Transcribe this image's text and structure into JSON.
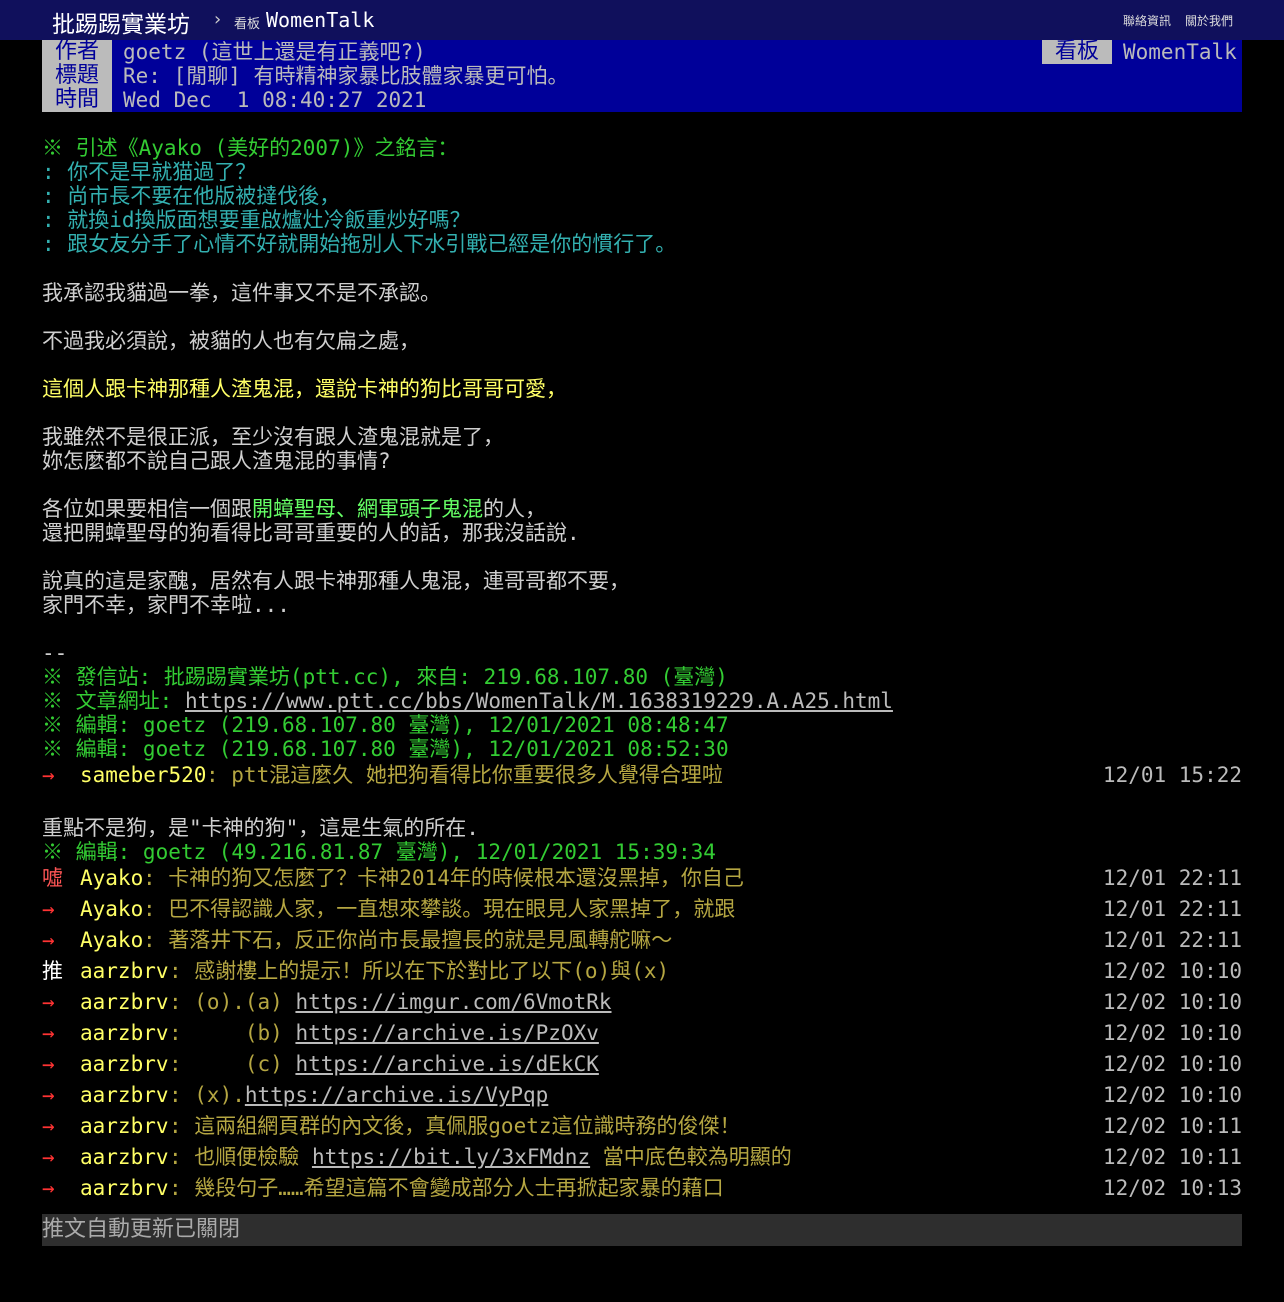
{
  "topbar": {
    "site": "批踢踢實業坊",
    "separator": "›",
    "board_label": "看板",
    "board": "WomenTalk",
    "nav_contact": "聯絡資訊",
    "nav_about": "關於我們"
  },
  "meta": {
    "author_tag": "作者",
    "author": "goetz (這世上還是有正義吧?)",
    "board_tag": "看板",
    "board": "WomenTalk",
    "title_tag": "標題",
    "title": "Re: [閒聊] 有時精神家暴比肢體家暴更可怕。",
    "time_tag": "時間",
    "time": "Wed Dec  1 08:40:27 2021"
  },
  "quote": {
    "header": "※ 引述《Ayako (美好的2007)》之銘言：",
    "lines": [
      ": 你不是早就猫過了？",
      ": 尚市長不要在他版被撻伐後，",
      ": 就換id換版面想要重啟爐灶冷飯重炒好嗎？",
      ": 跟女友分手了心情不好就開始拖別人下水引戰已經是你的慣行了。"
    ]
  },
  "body": {
    "p1": "我承認我貓過一拳，這件事又不是不承認。",
    "p2": "不過我必須說，被貓的人也有欠扁之處，",
    "p3": "這個人跟卡神那種人渣鬼混，還說卡神的狗比哥哥可愛，",
    "p4a": "我雖然不是很正派，至少沒有跟人渣鬼混就是了，",
    "p4b": "妳怎麼都不說自己跟人渣鬼混的事情?",
    "p5a_pre": "各位如果要相信一個跟",
    "p5a_hl": "開蟑聖母、網軍頭子鬼混",
    "p5a_post": "的人，",
    "p5b": "還把開蟑聖母的狗看得比哥哥重要的人的話，那我沒話說.",
    "p6a": "說真的這是家醜，居然有人跟卡神那種人鬼混，連哥哥都不要，",
    "p6b": "家門不幸，家門不幸啦..."
  },
  "signature": {
    "dash": "--",
    "sent_from": "※ 發信站: 批踢踢實業坊(ptt.cc), 來自: 219.68.107.80 (臺灣)",
    "url_label": "※ 文章網址: ",
    "url": "https://www.ptt.cc/bbs/WomenTalk/M.1638319229.A.A25.html",
    "edit1": "※ 編輯: goetz (219.68.107.80 臺灣), 12/01/2021 08:48:47",
    "edit2": "※ 編輯: goetz (219.68.107.80 臺灣), 12/01/2021 08:52:30"
  },
  "push1": {
    "tag": "→",
    "user": "sameber520",
    "content": ": ptt混這麼久 她把狗看得比你重要很多人覺得合理啦",
    "time": "12/01 15:22"
  },
  "reply": {
    "text": "重點不是狗，是\"卡神的狗\"，這是生氣的所在.",
    "edit3": "※ 編輯: goetz (49.216.81.87 臺灣), 12/01/2021 15:39:34"
  },
  "pushes": [
    {
      "tag": "噓",
      "user": "Ayako",
      "pre": ": 卡神的狗又怎麼了？卡神2014年的時候根本還沒黑掉，你自己",
      "link": "",
      "post": "",
      "time": "12/01 22:11"
    },
    {
      "tag": "→",
      "user": "Ayako",
      "pre": ": 巴不得認識人家，一直想來攀談。現在眼見人家黑掉了，就跟",
      "link": "",
      "post": "",
      "time": "12/01 22:11"
    },
    {
      "tag": "→",
      "user": "Ayako",
      "pre": ": 著落井下石，反正你尚市長最擅長的就是見風轉舵嘛～",
      "link": "",
      "post": "",
      "time": "12/01 22:11"
    },
    {
      "tag": "推",
      "user": "aarzbrv",
      "pre": ": 感謝樓上的提示！所以在下於對比了以下(o)與(x)",
      "link": "",
      "post": "",
      "time": "12/02 10:10"
    },
    {
      "tag": "→",
      "user": "aarzbrv",
      "pre": ": (o).(a) ",
      "link": "https://imgur.com/6VmotRk",
      "post": "",
      "time": "12/02 10:10"
    },
    {
      "tag": "→",
      "user": "aarzbrv",
      "pre": ":     (b) ",
      "link": "https://archive.is/PzOXv",
      "post": "",
      "time": "12/02 10:10"
    },
    {
      "tag": "→",
      "user": "aarzbrv",
      "pre": ":     (c) ",
      "link": "https://archive.is/dEkCK",
      "post": "",
      "time": "12/02 10:10"
    },
    {
      "tag": "→",
      "user": "aarzbrv",
      "pre": ": (x).",
      "link": "https://archive.is/VyPqp",
      "post": "",
      "time": "12/02 10:10"
    },
    {
      "tag": "→",
      "user": "aarzbrv",
      "pre": ": 這兩組網頁群的內文後，真佩服goetz這位識時務的俊傑！",
      "link": "",
      "post": "",
      "time": "12/02 10:11"
    },
    {
      "tag": "→",
      "user": "aarzbrv",
      "pre": ": 也順便檢驗 ",
      "link": "https://bit.ly/3xFMdnz",
      "post": " 當中底色較為明顯的",
      "time": "12/02 10:11"
    },
    {
      "tag": "→",
      "user": "aarzbrv",
      "pre": ": 幾段句子……希望這篇不會變成部分人士再掀起家暴的藉口",
      "link": "",
      "post": "",
      "time": "12/02 10:13"
    }
  ],
  "footer": {
    "closed": "推文自動更新已關閉"
  }
}
